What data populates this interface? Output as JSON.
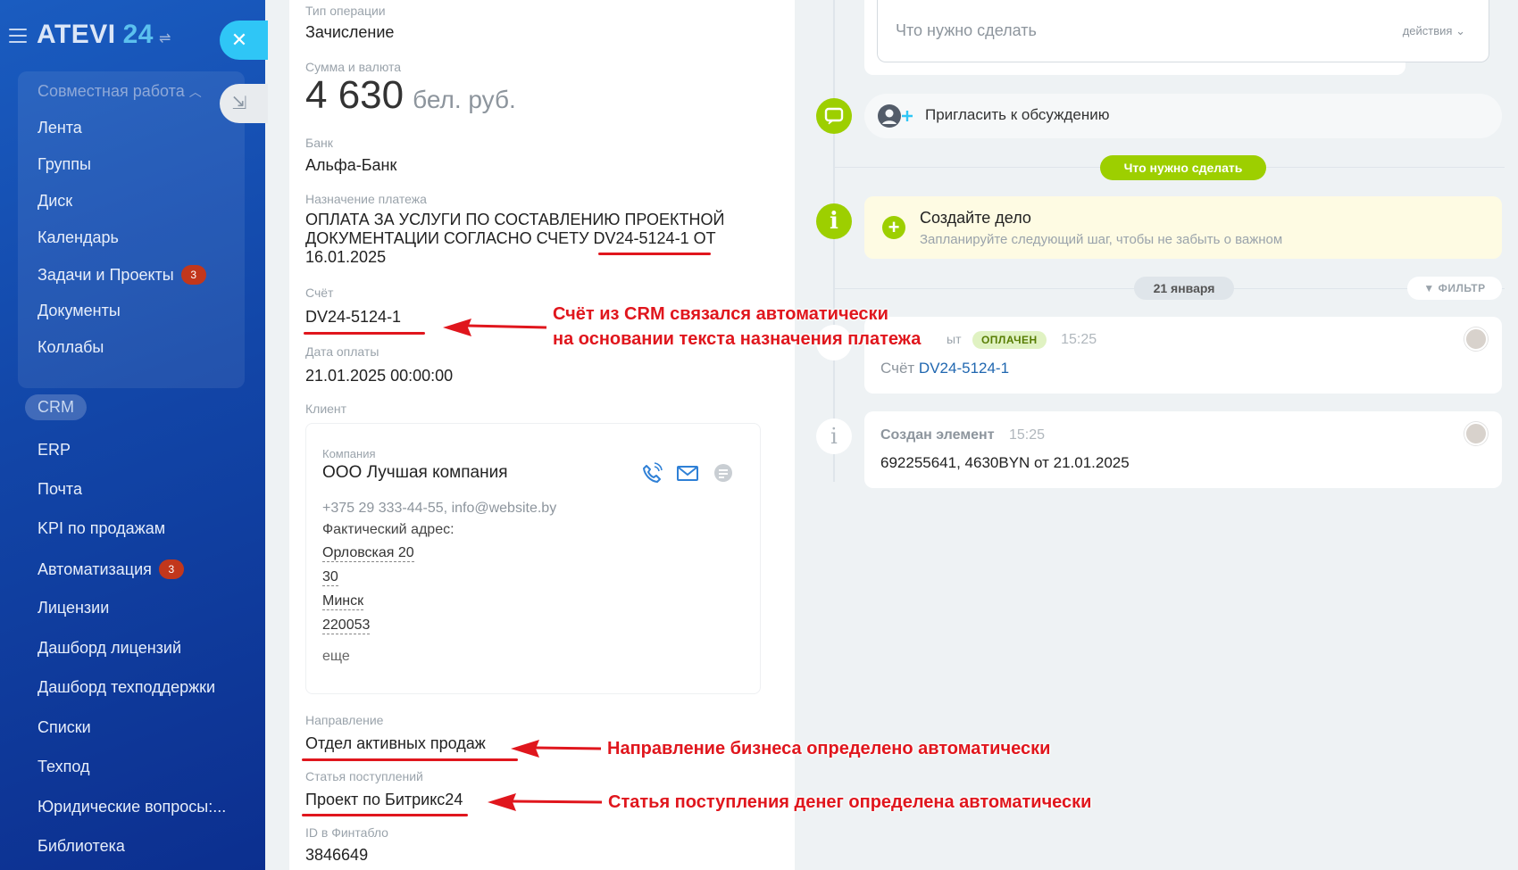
{
  "sidebar": {
    "logo_main": "ATEVI",
    "logo_num": "24",
    "group_title": "Совместная работа",
    "items": [
      {
        "label": "Лента"
      },
      {
        "label": "Группы"
      },
      {
        "label": "Диск"
      },
      {
        "label": "Календарь"
      },
      {
        "label": "Задачи и Проекты",
        "counter": "3"
      },
      {
        "label": "Документы"
      },
      {
        "label": "Коллабы"
      },
      {
        "label": "CRM"
      },
      {
        "label": "ERP"
      },
      {
        "label": "Почта"
      },
      {
        "label": "KPI по продажам"
      },
      {
        "label": "Автоматизация",
        "counter": "3"
      },
      {
        "label": "Лицензии"
      },
      {
        "label": "Дашборд лицензий"
      },
      {
        "label": "Дашборд техподдержки"
      },
      {
        "label": "Списки"
      },
      {
        "label": "Техпод"
      },
      {
        "label": "Юридические вопросы:..."
      },
      {
        "label": "Библиотека"
      }
    ]
  },
  "detail": {
    "op_type_label": "Тип операции",
    "op_type_value": "Зачисление",
    "amount_label": "Сумма и валюта",
    "amount_value": "4 630",
    "amount_currency": "бел. руб.",
    "bank_label": "Банк",
    "bank_value": "Альфа-Банк",
    "purpose_label": "Назначение платежа",
    "purpose_value": "ОПЛАТА ЗА УСЛУГИ ПО СОСТАВЛЕНИЮ ПРОЕКТНОЙ ДОКУМЕНТАЦИИ СОГЛАСНО СЧЕТУ DV24-5124-1 ОТ 16.01.2025",
    "invoice_label": "Счёт",
    "invoice_value": "DV24-5124-1",
    "paydate_label": "Дата оплаты",
    "paydate_value": "21.01.2025 00:00:00",
    "client_label": "Клиент",
    "client": {
      "company_label": "Компания",
      "company_name": "ООО Лучшая компания",
      "contacts": "+375 29 333-44-55, info@website.by",
      "address_label": "Фактический адрес:",
      "address_lines": [
        "Орловская 20",
        "30",
        "Минск",
        "220053"
      ],
      "more": "еще"
    },
    "direction_label": "Направление",
    "direction_value": "Отдел активных продаж",
    "income_item_label": "Статья поступлений",
    "income_item_value": "Проект по Битрикс24",
    "fintablo_label": "ID в Финтабло",
    "fintablo_value": "3846649"
  },
  "timeline": {
    "todo_placeholder": "Что нужно сделать",
    "todo_actions": "действия",
    "invite": "Пригласить к обсуждению",
    "todo_pill": "Что нужно сделать",
    "create_title": "Создайте дело",
    "create_sub": "Запланируйте следующий шаг, чтобы не забыть о важном",
    "date_pill": "21 января",
    "filter": "ФИЛЬТР",
    "event1": {
      "title_fragment": "ыт",
      "badge": "ОПЛАЧЕН",
      "time": "15:25",
      "invoice_prefix": "Счёт",
      "invoice_link": "DV24-5124-1"
    },
    "event2": {
      "title": "Создан элемент",
      "time": "15:25",
      "body": "692255641, 4630BYN от 21.01.2025"
    }
  },
  "annotations": {
    "a1_line1": "Счёт из CRM связался автоматически",
    "a1_line2": "на основании текста назначения платежа",
    "a2": "Направление бизнеса определено автоматически",
    "a3": "Статья поступления денег определена автоматически"
  },
  "colors": {
    "sidebar_gradient_start": "#1a5cc0",
    "sidebar_gradient_end": "#0c2f8f",
    "accent_cyan": "#2fc6f6",
    "accent_green": "#9dcf00",
    "annotation_red": "#e0161d",
    "counter_red": "#c2371c"
  }
}
